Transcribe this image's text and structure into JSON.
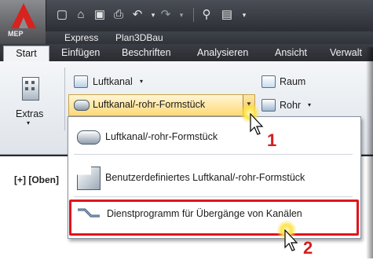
{
  "app": {
    "badge": "MEP"
  },
  "menu": [
    "Express",
    "Plan3DBau"
  ],
  "tabs": {
    "active": "Start",
    "others": [
      "Einfügen",
      "Beschriften",
      "Analysieren",
      "Ansicht",
      "Verwalt"
    ]
  },
  "ribbon": {
    "extras_label": "Extras",
    "luftkanal_label": "Luftkanal",
    "formstueck_label": "Luftkanal/-rohr-Formstück",
    "raum_label": "Raum",
    "rohr_label": "Rohr"
  },
  "dropdown": {
    "items": [
      "Luftkanal/-rohr-Formstück",
      "Benutzerdefiniertes Luftkanal/-rohr-Formstück",
      "Dienstprogramm für Übergänge von Kanälen"
    ]
  },
  "viewport": {
    "label": "[+] [Oben]"
  },
  "callouts": {
    "step1": "1",
    "step2": "2"
  },
  "colors": {
    "highlight": "#e0141c",
    "callout": "#d61e1e",
    "hover": "#ffd97a"
  }
}
